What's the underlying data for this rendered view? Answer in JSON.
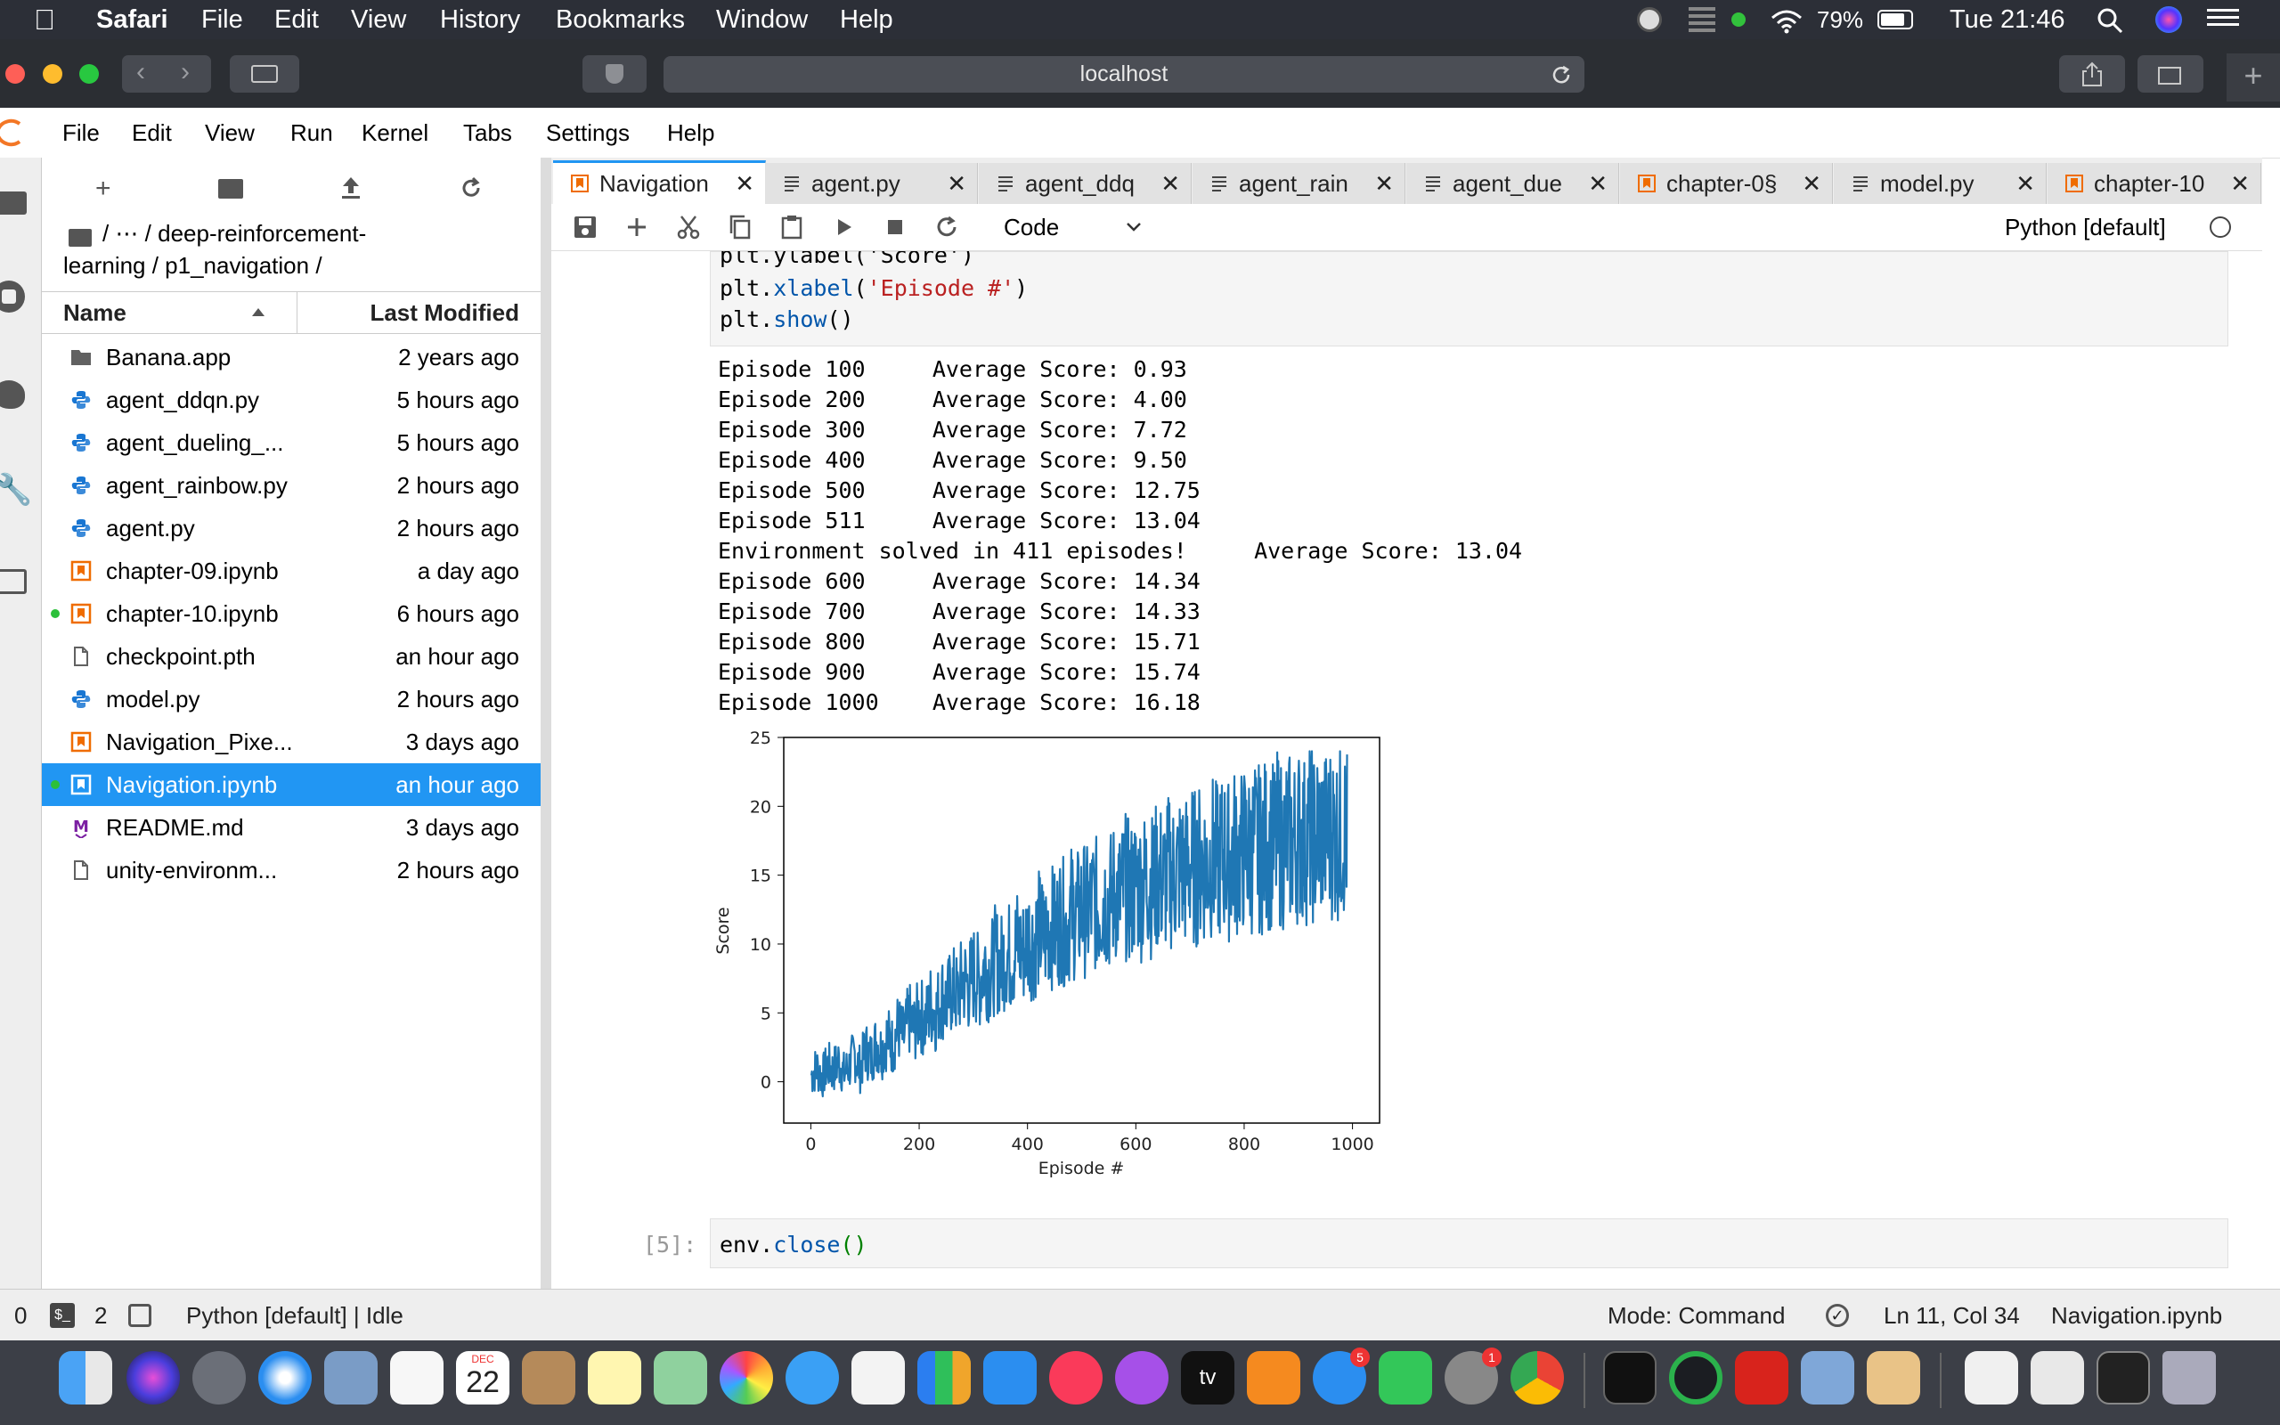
{
  "menubar": {
    "app": "Safari",
    "items": [
      "File",
      "Edit",
      "View",
      "History",
      "Bookmarks",
      "Window",
      "Help"
    ],
    "battery": "79%",
    "clock": "Tue 21:46"
  },
  "browser": {
    "url": "localhost"
  },
  "jupyter_menu": [
    "File",
    "Edit",
    "View",
    "Run",
    "Kernel",
    "Tabs",
    "Settings",
    "Help"
  ],
  "filebrowser": {
    "breadcrumb_line1": "/ ⋯ / deep-reinforcement-",
    "breadcrumb_line2": "learning / p1_navigation /",
    "col_name": "Name",
    "col_modified": "Last Modified",
    "files": [
      {
        "name": "Banana.app",
        "modified": "2 years ago",
        "icon": "folder-icon"
      },
      {
        "name": "agent_ddqn.py",
        "modified": "5 hours ago",
        "icon": "python-icon"
      },
      {
        "name": "agent_dueling_...",
        "modified": "5 hours ago",
        "icon": "python-icon"
      },
      {
        "name": "agent_rainbow.py",
        "modified": "2 hours ago",
        "icon": "python-icon"
      },
      {
        "name": "agent.py",
        "modified": "2 hours ago",
        "icon": "python-icon"
      },
      {
        "name": "chapter-09.ipynb",
        "modified": "a day ago",
        "icon": "notebook-icon"
      },
      {
        "name": "chapter-10.ipynb",
        "modified": "6 hours ago",
        "icon": "notebook-icon"
      },
      {
        "name": "checkpoint.pth",
        "modified": "an hour ago",
        "icon": "file-icon"
      },
      {
        "name": "model.py",
        "modified": "2 hours ago",
        "icon": "python-icon"
      },
      {
        "name": "Navigation_Pixe...",
        "modified": "3 days ago",
        "icon": "notebook-icon"
      },
      {
        "name": "Navigation.ipynb",
        "modified": "an hour ago",
        "icon": "notebook-icon"
      },
      {
        "name": "README.md",
        "modified": "3 days ago",
        "icon": "markdown-icon"
      },
      {
        "name": "unity-environm...",
        "modified": "2 hours ago",
        "icon": "file-icon"
      }
    ]
  },
  "tabs": [
    {
      "label": "Navigation",
      "icon": "notebook-icon"
    },
    {
      "label": "agent.py",
      "icon": "text-file-icon"
    },
    {
      "label": "agent_ddq",
      "icon": "text-file-icon"
    },
    {
      "label": "agent_rain",
      "icon": "text-file-icon"
    },
    {
      "label": "agent_due",
      "icon": "text-file-icon"
    },
    {
      "label": "chapter-0§",
      "icon": "notebook-icon"
    },
    {
      "label": "model.py",
      "icon": "text-file-icon"
    },
    {
      "label": "chapter-10",
      "icon": "notebook-icon"
    }
  ],
  "notebook_toolbar": {
    "cell_type": "Code",
    "kernel": "Python [default]"
  },
  "cell_input": {
    "line0": "plt.ylabel('Score')",
    "line1_a": "plt.",
    "line1_fn": "xlabel",
    "line1_b": "(",
    "line1_str": "'Episode #'",
    "line1_c": ")",
    "line2_a": "plt.",
    "line2_fn": "show",
    "line2_b": "()"
  },
  "output_lines": [
    "Episode 100\tAverage Score: 0.93",
    "Episode 200\tAverage Score: 4.00",
    "Episode 300\tAverage Score: 7.72",
    "Episode 400\tAverage Score: 9.50",
    "Episode 500\tAverage Score: 12.75",
    "Episode 511\tAverage Score: 13.04",
    "Environment solved in 411 episodes!\tAverage Score: 13.04",
    "Episode 600\tAverage Score: 14.34",
    "Episode 700\tAverage Score: 14.33",
    "Episode 800\tAverage Score: 15.71",
    "Episode 900\tAverage Score: 15.74",
    "Episode 1000\tAverage Score: 16.18"
  ],
  "chart_data": {
    "type": "line",
    "title": "",
    "xlabel": "Episode #",
    "ylabel": "Score",
    "xlim": [
      -50,
      1050
    ],
    "ylim": [
      -3,
      25
    ],
    "xticks": [
      0,
      200,
      400,
      600,
      800,
      1000
    ],
    "yticks": [
      0,
      5,
      10,
      15,
      20,
      25
    ],
    "series_color": "#1f77b4",
    "series": [
      {
        "x_start": 1,
        "x_step": 10,
        "values": [
          0.5,
          1.0,
          0.3,
          1.2,
          0.8,
          1.5,
          0.6,
          1.1,
          2.0,
          0.9,
          2.4,
          1.7,
          2.9,
          2.2,
          3.3,
          2.6,
          4.0,
          3.1,
          4.6,
          3.8,
          5.1,
          4.2,
          5.6,
          4.9,
          6.3,
          5.7,
          6.8,
          6.1,
          7.5,
          6.9,
          7.9,
          7.2,
          8.6,
          7.8,
          9.0,
          8.4,
          9.5,
          8.9,
          10.1,
          9.3,
          10.6,
          10.0,
          11.0,
          10.4,
          11.5,
          10.9,
          12.0,
          11.2,
          12.4,
          11.9,
          12.8,
          12.2,
          13.1,
          12.6,
          13.5,
          12.9,
          13.9,
          13.3,
          14.2,
          13.6,
          14.5,
          14.0,
          14.8,
          14.2,
          15.0,
          14.5,
          15.3,
          14.9,
          15.6,
          15.2,
          15.9,
          15.4,
          16.1,
          15.6,
          16.4,
          15.8,
          16.6,
          16.0,
          16.8,
          16.3,
          17.0,
          16.5,
          17.2,
          16.7,
          17.4,
          16.9,
          17.6,
          17.1,
          17.8,
          17.3,
          18.0,
          17.5,
          18.1,
          17.6,
          18.2,
          17.8,
          18.3,
          17.9,
          18.4,
          18.0
        ]
      }
    ]
  },
  "next_cell": {
    "prompt": "[5]:",
    "code_a": "env.",
    "code_fn": "close",
    "code_b": "()"
  },
  "statusbar": {
    "zero": "0",
    "terminals": "2",
    "kernel_status": "Python [default] | Idle",
    "mode": "Mode: Command",
    "position": "Ln 11, Col 34",
    "filename": "Navigation.ipynb"
  },
  "dock": {
    "calendar_month": "DEC",
    "calendar_day": "22",
    "appstore_badge": "5",
    "prefs_badge": "1",
    "tv_label": "tv"
  }
}
